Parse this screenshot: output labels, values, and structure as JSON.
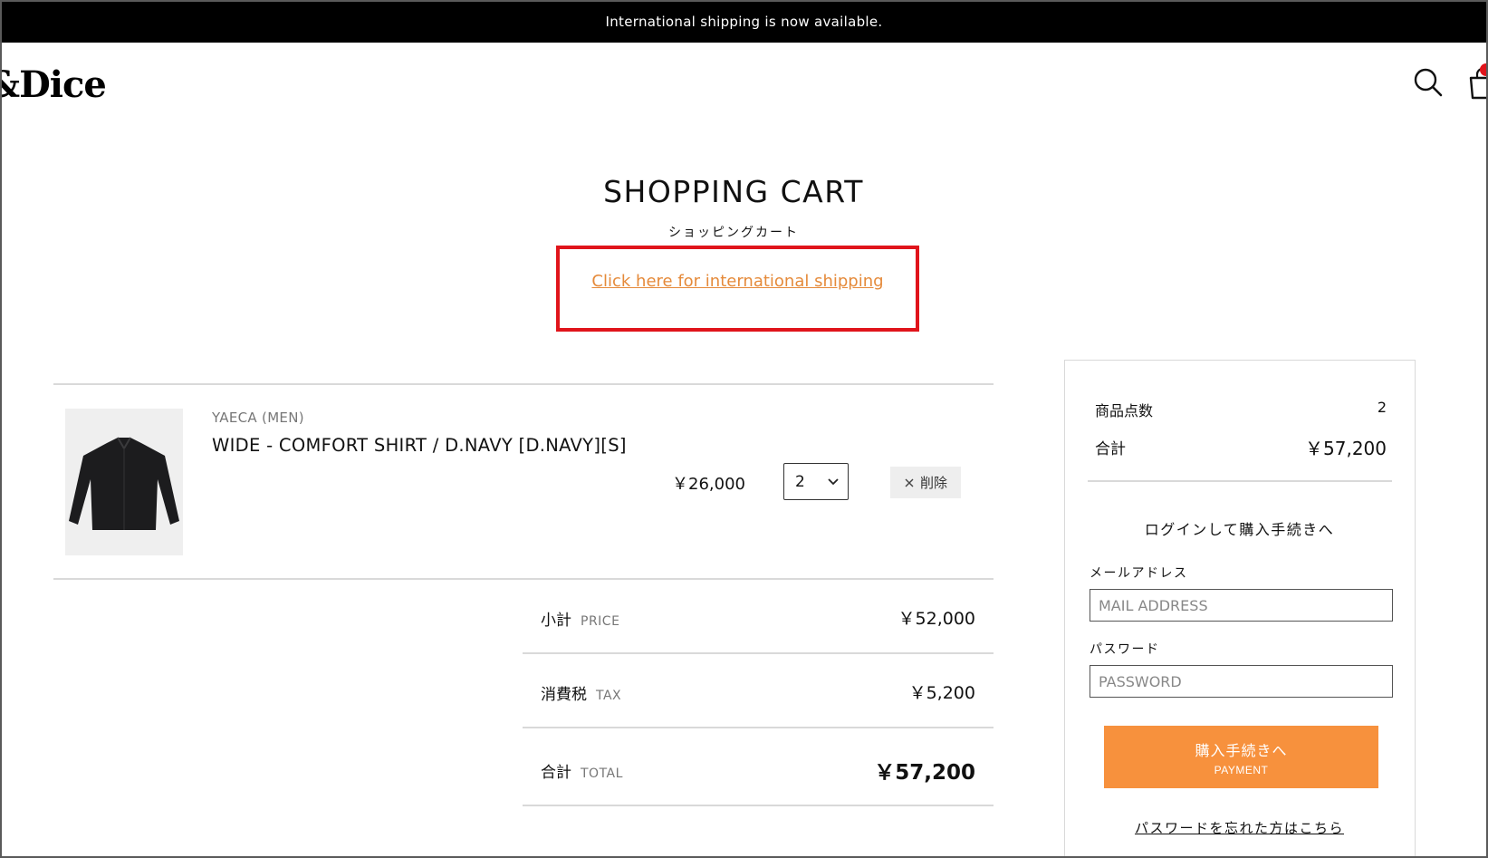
{
  "announcement": "International shipping is now available.",
  "header": {
    "logo_text": "&Dice"
  },
  "page": {
    "title": "SHOPPING CART",
    "subtitle": "ショッピングカート",
    "intl_link": "Click here for international shipping"
  },
  "cart": {
    "items": [
      {
        "brand": "YAECA (MEN)",
        "name": "WIDE - COMFORT SHIRT / D.NAVY [D.NAVY][S]",
        "price": "￥26,000",
        "quantity": "2",
        "remove_label": "削除"
      }
    ],
    "summary": {
      "subtotal": {
        "label": "小計",
        "label_en": "PRICE",
        "value": "￥52,000"
      },
      "tax": {
        "label": "消費税",
        "label_en": "TAX",
        "value": "￥5,200"
      },
      "total": {
        "label": "合計",
        "label_en": "TOTAL",
        "value": "￥57,200"
      }
    }
  },
  "sidebar": {
    "item_count_label": "商品点数",
    "item_count_value": "2",
    "total_label": "合計",
    "total_value": "￥57,200",
    "login_heading": "ログインして購入手続きへ",
    "email_label": "メールアドレス",
    "email_placeholder": "MAIL ADDRESS",
    "password_label": "パスワード",
    "password_placeholder": "PASSWORD",
    "pay_button_jp": "購入手続きへ",
    "pay_button_en": "PAYMENT",
    "forgot_link": "パスワードを忘れた方はこちら"
  },
  "colors": {
    "accent_orange": "#f7913d",
    "link_orange": "#e58a3a",
    "highlight_red": "#e0141b"
  },
  "icons": [
    "search-icon",
    "cart-icon",
    "chevron-down-icon",
    "close-icon"
  ]
}
